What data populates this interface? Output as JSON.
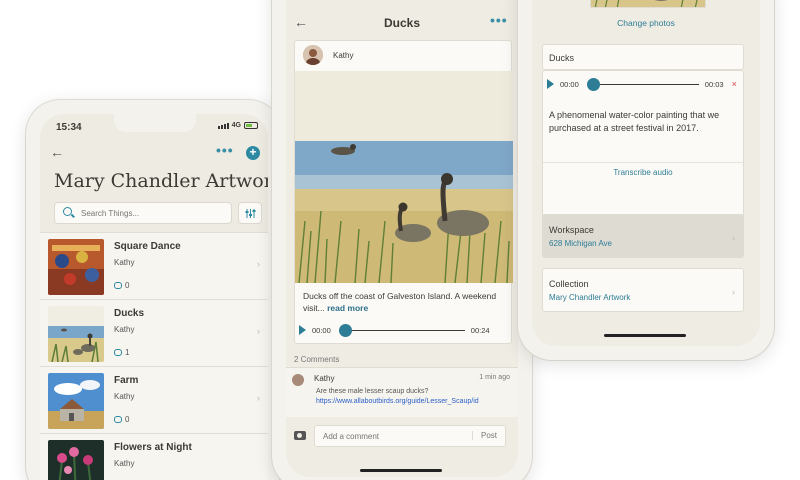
{
  "left_screen": {
    "status_time": "15:34",
    "status_network": "4G",
    "title": "Mary Chandler Artwork",
    "search_placeholder": "Search Things...",
    "items": [
      {
        "title": "Square Dance",
        "author": "Kathy",
        "comments": "0"
      },
      {
        "title": "Ducks",
        "author": "Kathy",
        "comments": "1"
      },
      {
        "title": "Farm",
        "author": "Kathy",
        "comments": "0"
      },
      {
        "title": "Flowers at Night",
        "author": "Kathy",
        "comments": ""
      }
    ]
  },
  "middle_screen": {
    "title": "Ducks",
    "poster": "Kathy",
    "caption": "Ducks off the coast of Galveston Island. A weekend visit...",
    "read_more": "read more",
    "audio_start": "00:00",
    "audio_end": "00:24",
    "audio_progress": 0.0,
    "comments_count": "2 Comments",
    "comment": {
      "author": "Kathy",
      "time": "1 min ago",
      "text": "Are these male lesser scaup ducks?",
      "link": "https://www.allaboutbirds.org/guide/Lesser_Scaup/id"
    },
    "comment_placeholder": "Add a comment",
    "post_label": "Post"
  },
  "right_screen": {
    "change_photos": "Change photos",
    "name_value": "Ducks",
    "audio_start": "00:00",
    "audio_end": "00:03",
    "delete_symbol": "×",
    "description": "A phenomenal water-color painting that we purchased at a street festival in 2017.",
    "transcribe": "Transcribe audio",
    "workspace_label": "Workspace",
    "workspace_value": "628 Michigan Ave",
    "collection_label": "Collection",
    "collection_value": "Mary Chandler Artwork"
  },
  "icons": {
    "back": "back-arrow-icon",
    "more": "more-dots-icon",
    "add": "plus-icon",
    "search": "search-icon",
    "filter": "filter-sliders-icon",
    "comment": "comment-bubble-icon",
    "play": "play-icon",
    "camera": "camera-icon"
  },
  "colors": {
    "accent": "#2e8aa3",
    "link": "#2b5ec9",
    "background": "#eeebe3",
    "delete": "#d04040"
  }
}
